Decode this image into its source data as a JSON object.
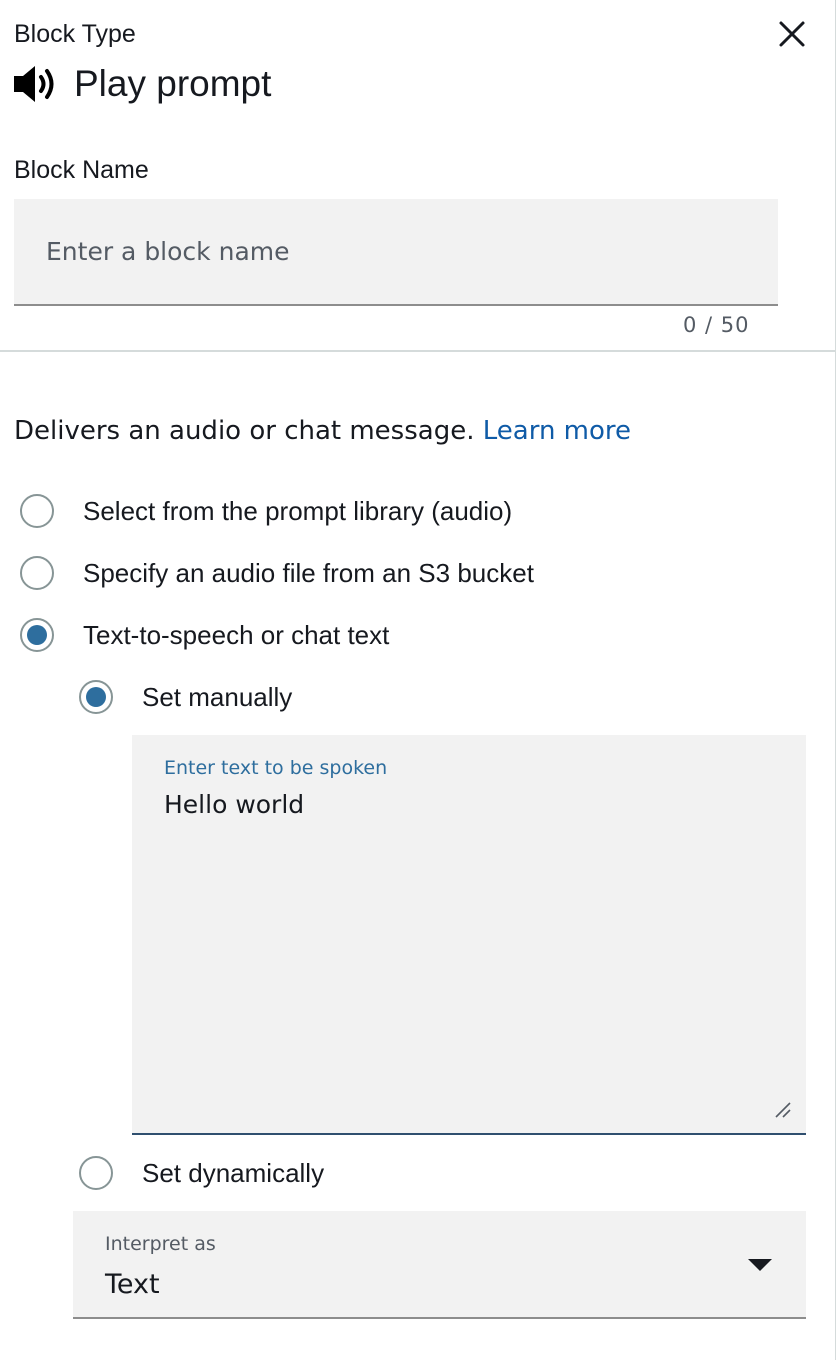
{
  "header": {
    "block_type_label": "Block Type",
    "title": "Play prompt",
    "title_icon": "speaker-icon",
    "close_icon": "close-icon"
  },
  "block_name": {
    "label": "Block Name",
    "value": "",
    "placeholder": "Enter a block name",
    "char_count": "0 / 50"
  },
  "description": {
    "text": "Delivers an audio or chat message.",
    "link": "Learn more"
  },
  "prompt_source": {
    "options": [
      {
        "label": "Select from the prompt library (audio)",
        "selected": false
      },
      {
        "label": "Specify an audio file from an S3 bucket",
        "selected": false
      },
      {
        "label": "Text-to-speech or chat text",
        "selected": true
      }
    ]
  },
  "tts": {
    "set_manually_label": "Set manually",
    "set_manually_selected": true,
    "text_label": "Enter text to be spoken",
    "text_value": "Hello world",
    "set_dynamically_label": "Set dynamically",
    "set_dynamically_selected": false
  },
  "interpret_as": {
    "label": "Interpret as",
    "value": "Text"
  },
  "colors": {
    "accent": "#2e6e9e",
    "link": "#0f5ba7",
    "field_bg": "#f2f2f2"
  }
}
